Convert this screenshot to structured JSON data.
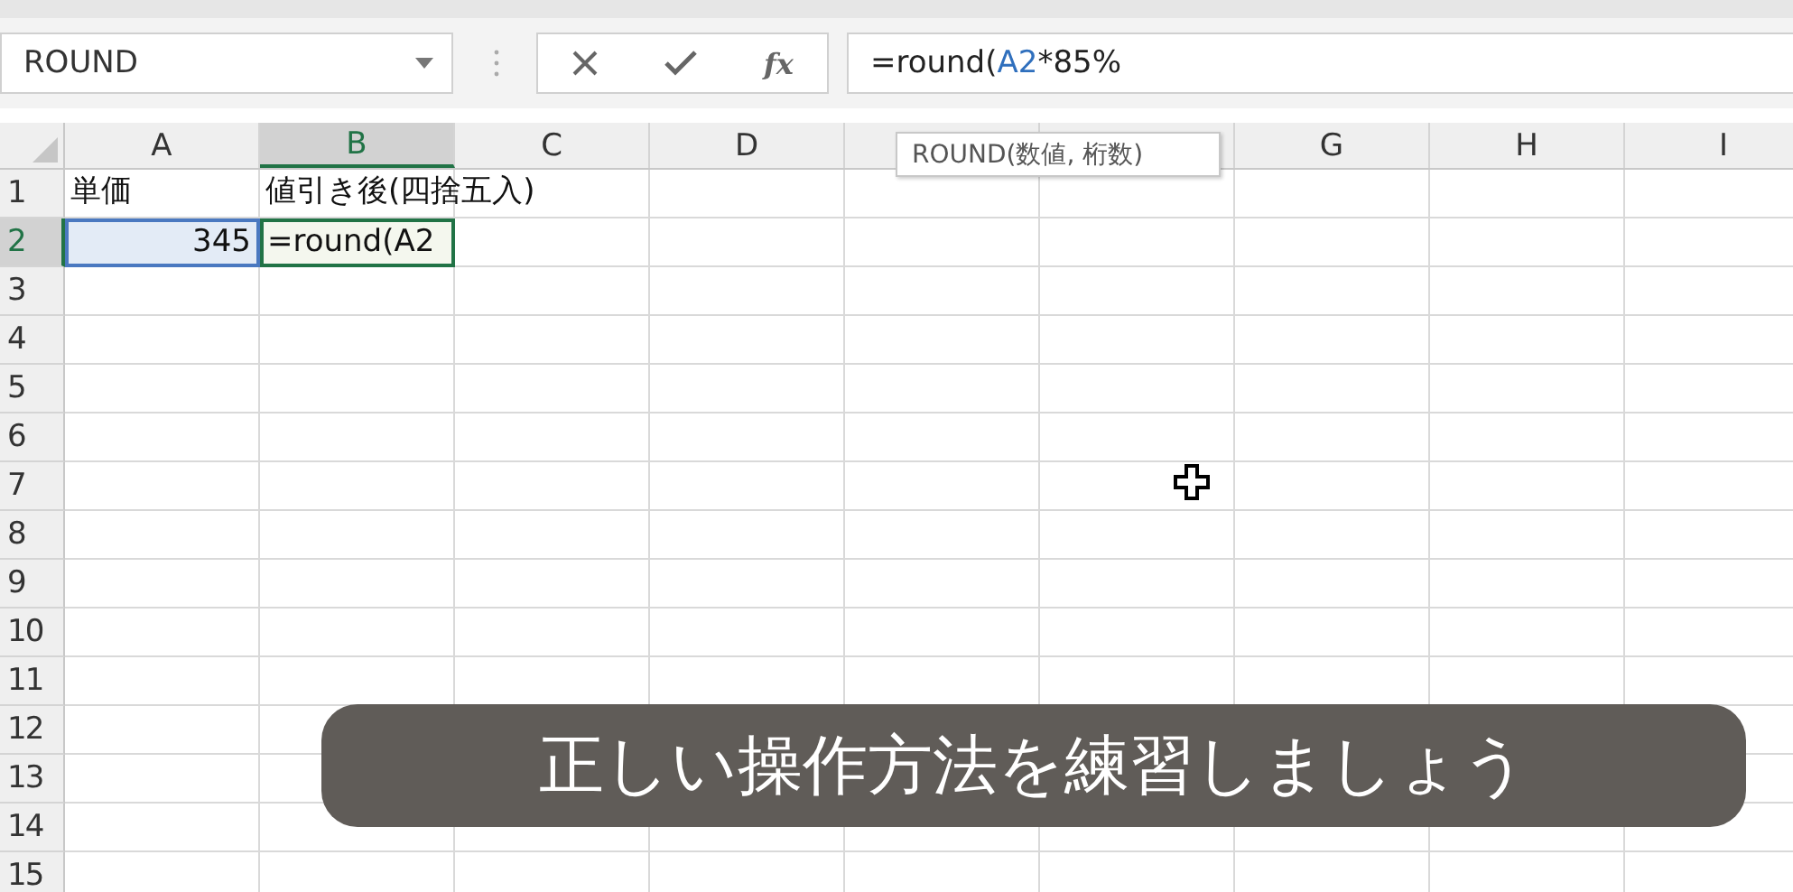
{
  "name_box": {
    "value": "ROUND"
  },
  "formula_buttons": [
    {
      "kind": "cancel"
    },
    {
      "kind": "enter"
    },
    {
      "kind": "function",
      "label": "fx"
    }
  ],
  "formula_bar": {
    "parts": [
      {
        "text": "=round(",
        "kind": "plain"
      },
      {
        "text": "A2",
        "kind": "reference"
      },
      {
        "text": "*85%",
        "kind": "plain"
      }
    ]
  },
  "tooltip": {
    "text": "ROUND(数値, 桁数)"
  },
  "columns": [
    {
      "label": "A",
      "selected": false
    },
    {
      "label": "B",
      "selected": true
    },
    {
      "label": "C",
      "selected": false
    },
    {
      "label": "D",
      "selected": false
    },
    {
      "selected": false
    },
    {
      "selected": false
    },
    {
      "label": "G",
      "selected": false
    },
    {
      "label": "H",
      "selected": false
    },
    {
      "label": "I",
      "selected": false
    }
  ],
  "rows": [
    {
      "label": "1",
      "selected": false,
      "cells": [
        {
          "text": "単価"
        },
        {
          "text": "値引き後(四捨五入)"
        }
      ]
    },
    {
      "label": "2",
      "selected": true,
      "cells": [
        {
          "text": "345",
          "right_aligned": true,
          "kind": "reference"
        },
        {
          "text": "=round(A2",
          "kind": "editing"
        }
      ]
    },
    {
      "label": "3",
      "selected": false,
      "cells": []
    },
    {
      "label": "4",
      "selected": false,
      "cells": []
    },
    {
      "label": "5",
      "selected": false,
      "cells": []
    },
    {
      "label": "6",
      "selected": false,
      "cells": []
    },
    {
      "label": "7",
      "selected": false,
      "cells": []
    },
    {
      "label": "8",
      "selected": false,
      "cells": []
    },
    {
      "label": "9",
      "selected": false,
      "cells": []
    },
    {
      "label": "10",
      "selected": false,
      "cells": []
    },
    {
      "label": "11",
      "selected": false,
      "cells": []
    },
    {
      "label": "12",
      "selected": false,
      "cells": []
    },
    {
      "label": "13",
      "selected": false,
      "cells": []
    },
    {
      "label": "14",
      "selected": false,
      "cells": []
    },
    {
      "label": "15",
      "selected": false,
      "cells": []
    }
  ],
  "caption": {
    "text": "正しい操作方法を練習しましょう"
  }
}
